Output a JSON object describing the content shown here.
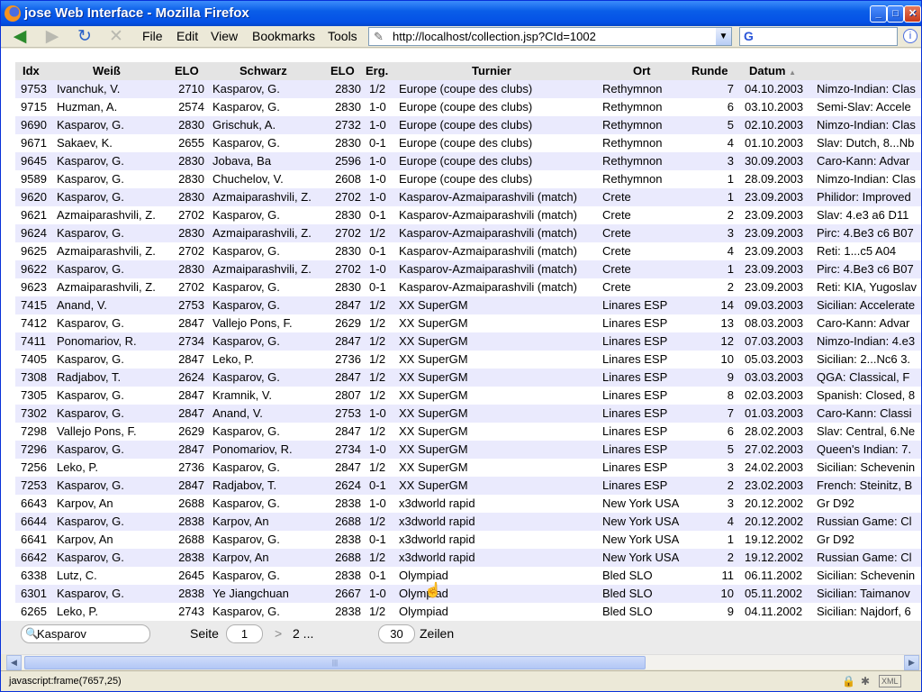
{
  "window": {
    "title": "jose Web Interface - Mozilla Firefox",
    "minimize_icon": "_",
    "maximize_icon": "□",
    "close_icon": "✕"
  },
  "nav": {
    "back_icon": "◀",
    "forward_icon": "▶",
    "reload_icon": "↻",
    "stop_icon": "✕",
    "menus": [
      "File",
      "Edit",
      "View",
      "Bookmarks",
      "Tools"
    ],
    "url": "http://localhost/collection.jsp?CId=1002",
    "url_icon": "✎",
    "url_dropdown_icon": "▼",
    "search_engine_icon": "G",
    "info_icon": "i"
  },
  "table": {
    "headers": {
      "idx": "Idx",
      "white": "Weiß",
      "elo_w": "ELO",
      "black": "Schwarz",
      "elo_b": "ELO",
      "result": "Erg.",
      "event": "Turnier",
      "site": "Ort",
      "round": "Runde",
      "date": "Datum",
      "sort_icon": "▲"
    },
    "rows": [
      [
        "9753",
        "Ivanchuk, V.",
        "2710",
        "Kasparov, G.",
        "2830",
        "1/2",
        "Europe (coupe des clubs)",
        "Rethymnon",
        "7",
        "04.10.2003",
        "Nimzo-Indian: Clas"
      ],
      [
        "9715",
        "Huzman, A.",
        "2574",
        "Kasparov, G.",
        "2830",
        "1-0",
        "Europe (coupe des clubs)",
        "Rethymnon",
        "6",
        "03.10.2003",
        "Semi-Slav: Accele"
      ],
      [
        "9690",
        "Kasparov, G.",
        "2830",
        "Grischuk, A.",
        "2732",
        "1-0",
        "Europe (coupe des clubs)",
        "Rethymnon",
        "5",
        "02.10.2003",
        "Nimzo-Indian: Clas"
      ],
      [
        "9671",
        "Sakaev, K.",
        "2655",
        "Kasparov, G.",
        "2830",
        "0-1",
        "Europe (coupe des clubs)",
        "Rethymnon",
        "4",
        "01.10.2003",
        "Slav: Dutch, 8...Nb"
      ],
      [
        "9645",
        "Kasparov, G.",
        "2830",
        "Jobava, Ba",
        "2596",
        "1-0",
        "Europe (coupe des clubs)",
        "Rethymnon",
        "3",
        "30.09.2003",
        "Caro-Kann: Advar"
      ],
      [
        "9589",
        "Kasparov, G.",
        "2830",
        "Chuchelov, V.",
        "2608",
        "1-0",
        "Europe (coupe des clubs)",
        "Rethymnon",
        "1",
        "28.09.2003",
        "Nimzo-Indian: Clas"
      ],
      [
        "9620",
        "Kasparov, G.",
        "2830",
        "Azmaiparashvili, Z.",
        "2702",
        "1-0",
        "Kasparov-Azmaiparashvili (match)",
        "Crete",
        "1",
        "23.09.2003",
        "Philidor: Improved"
      ],
      [
        "9621",
        "Azmaiparashvili, Z.",
        "2702",
        "Kasparov, G.",
        "2830",
        "0-1",
        "Kasparov-Azmaiparashvili (match)",
        "Crete",
        "2",
        "23.09.2003",
        "Slav: 4.e3 a6 D11"
      ],
      [
        "9624",
        "Kasparov, G.",
        "2830",
        "Azmaiparashvili, Z.",
        "2702",
        "1/2",
        "Kasparov-Azmaiparashvili (match)",
        "Crete",
        "3",
        "23.09.2003",
        "Pirc: 4.Be3 c6 B07"
      ],
      [
        "9625",
        "Azmaiparashvili, Z.",
        "2702",
        "Kasparov, G.",
        "2830",
        "0-1",
        "Kasparov-Azmaiparashvili (match)",
        "Crete",
        "4",
        "23.09.2003",
        "Reti: 1...c5 A04"
      ],
      [
        "9622",
        "Kasparov, G.",
        "2830",
        "Azmaiparashvili, Z.",
        "2702",
        "1-0",
        "Kasparov-Azmaiparashvili (match)",
        "Crete",
        "1",
        "23.09.2003",
        "Pirc: 4.Be3 c6 B07"
      ],
      [
        "9623",
        "Azmaiparashvili, Z.",
        "2702",
        "Kasparov, G.",
        "2830",
        "0-1",
        "Kasparov-Azmaiparashvili (match)",
        "Crete",
        "2",
        "23.09.2003",
        "Reti: KIA, Yugoslav"
      ],
      [
        "7415",
        "Anand, V.",
        "2753",
        "Kasparov, G.",
        "2847",
        "1/2",
        "XX SuperGM",
        "Linares ESP",
        "14",
        "09.03.2003",
        "Sicilian: Accelerate"
      ],
      [
        "7412",
        "Kasparov, G.",
        "2847",
        "Vallejo Pons, F.",
        "2629",
        "1/2",
        "XX SuperGM",
        "Linares ESP",
        "13",
        "08.03.2003",
        "Caro-Kann: Advar"
      ],
      [
        "7411",
        "Ponomariov, R.",
        "2734",
        "Kasparov, G.",
        "2847",
        "1/2",
        "XX SuperGM",
        "Linares ESP",
        "12",
        "07.03.2003",
        "Nimzo-Indian: 4.e3"
      ],
      [
        "7405",
        "Kasparov, G.",
        "2847",
        "Leko, P.",
        "2736",
        "1/2",
        "XX SuperGM",
        "Linares ESP",
        "10",
        "05.03.2003",
        "Sicilian: 2...Nc6 3."
      ],
      [
        "7308",
        "Radjabov, T.",
        "2624",
        "Kasparov, G.",
        "2847",
        "1/2",
        "XX SuperGM",
        "Linares ESP",
        "9",
        "03.03.2003",
        "QGA: Classical, F"
      ],
      [
        "7305",
        "Kasparov, G.",
        "2847",
        "Kramnik, V.",
        "2807",
        "1/2",
        "XX SuperGM",
        "Linares ESP",
        "8",
        "02.03.2003",
        "Spanish: Closed, 8"
      ],
      [
        "7302",
        "Kasparov, G.",
        "2847",
        "Anand, V.",
        "2753",
        "1-0",
        "XX SuperGM",
        "Linares ESP",
        "7",
        "01.03.2003",
        "Caro-Kann: Classi"
      ],
      [
        "7298",
        "Vallejo Pons, F.",
        "2629",
        "Kasparov, G.",
        "2847",
        "1/2",
        "XX SuperGM",
        "Linares ESP",
        "6",
        "28.02.2003",
        "Slav: Central, 6.Ne"
      ],
      [
        "7296",
        "Kasparov, G.",
        "2847",
        "Ponomariov, R.",
        "2734",
        "1-0",
        "XX SuperGM",
        "Linares ESP",
        "5",
        "27.02.2003",
        "Queen's Indian: 7."
      ],
      [
        "7256",
        "Leko, P.",
        "2736",
        "Kasparov, G.",
        "2847",
        "1/2",
        "XX SuperGM",
        "Linares ESP",
        "3",
        "24.02.2003",
        "Sicilian: Schevenin"
      ],
      [
        "7253",
        "Kasparov, G.",
        "2847",
        "Radjabov, T.",
        "2624",
        "0-1",
        "XX SuperGM",
        "Linares ESP",
        "2",
        "23.02.2003",
        "French: Steinitz, B"
      ],
      [
        "6643",
        "Karpov, An",
        "2688",
        "Kasparov, G.",
        "2838",
        "1-0",
        "x3dworld rapid",
        "New York USA",
        "3",
        "20.12.2002",
        "Gr D92"
      ],
      [
        "6644",
        "Kasparov, G.",
        "2838",
        "Karpov, An",
        "2688",
        "1/2",
        "x3dworld rapid",
        "New York USA",
        "4",
        "20.12.2002",
        "Russian Game: Cl"
      ],
      [
        "6641",
        "Karpov, An",
        "2688",
        "Kasparov, G.",
        "2838",
        "0-1",
        "x3dworld rapid",
        "New York USA",
        "1",
        "19.12.2002",
        "Gr D92"
      ],
      [
        "6642",
        "Kasparov, G.",
        "2838",
        "Karpov, An",
        "2688",
        "1/2",
        "x3dworld rapid",
        "New York USA",
        "2",
        "19.12.2002",
        "Russian Game: Cl"
      ],
      [
        "6338",
        "Lutz, C.",
        "2645",
        "Kasparov, G.",
        "2838",
        "0-1",
        "Olympiad",
        "Bled SLO",
        "11",
        "06.11.2002",
        "Sicilian: Schevenin"
      ],
      [
        "6301",
        "Kasparov, G.",
        "2838",
        "Ye Jiangchuan",
        "2667",
        "1-0",
        "Olympiad",
        "Bled SLO",
        "10",
        "05.11.2002",
        "Sicilian: Taimanov"
      ],
      [
        "6265",
        "Leko, P.",
        "2743",
        "Kasparov, G.",
        "2838",
        "1/2",
        "Olympiad",
        "Bled SLO",
        "9",
        "04.11.2002",
        "Sicilian: Najdorf, 6"
      ]
    ]
  },
  "footer": {
    "search_value": "Kasparov",
    "search_icon": "🔍",
    "page_label": "Seite",
    "page_value": "1",
    "next_arrow": ">",
    "total_pages": "2 ...",
    "rows_value": "30",
    "rows_label": "Zeilen"
  },
  "scrollbar": {
    "left_arrow": "◀",
    "right_arrow": "▶",
    "grip": "|||"
  },
  "statusbar": {
    "text": "javascript:frame(7657,25)",
    "lock_icon": "🔒",
    "bug_icon": "✱",
    "xml_icon": "XML"
  },
  "cursor": "☝"
}
